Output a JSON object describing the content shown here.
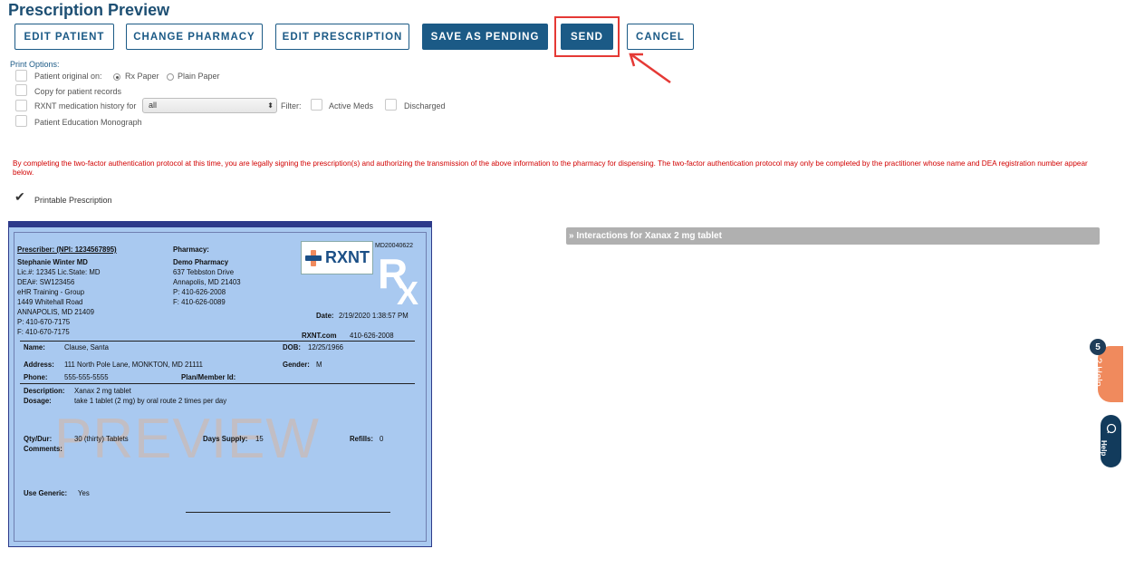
{
  "page": {
    "title": "Prescription Preview"
  },
  "toolbar": {
    "edit_patient": "EDIT PATIENT",
    "change_pharmacy": "CHANGE PHARMACY",
    "edit_prescription": "EDIT PRESCRIPTION",
    "save_pending": "SAVE AS PENDING",
    "send": "SEND",
    "cancel": "CANCEL"
  },
  "print_options": {
    "label": "Print Options:",
    "patient_original": "Patient original on:",
    "rx_paper": "Rx Paper",
    "plain_paper": "Plain Paper",
    "copy_records": "Copy for patient records",
    "med_history": "RXNT medication history for",
    "med_history_value": "all",
    "filter": "Filter:",
    "active_meds": "Active Meds",
    "discharged": "Discharged",
    "education": "Patient Education Monograph"
  },
  "warning": "By completing the two-factor authentication protocol at this time, you are legally signing the prescription(s) and authorizing the transmission of the above information to the pharmacy for dispensing. The two-factor authentication protocol may only be completed by the practitioner whose name and DEA registration number appear below.",
  "printable": "Printable Prescription",
  "rx": {
    "prescriber_header": "Prescriber: (NPI: 1234567895)",
    "prescriber_lines": [
      "Stephanie Winter MD",
      "Lic.#: 12345 Lic.State: MD",
      "DEA#: SW123456",
      "eHR Training - Group",
      "1449 Whitehall Road",
      "ANNAPOLIS,  MD 21409",
      "P: 410-670-7175",
      "F: 410-670-7175"
    ],
    "pharmacy_header": "Pharmacy:",
    "pharmacy_lines": [
      "Demo Pharmacy",
      "637 Tebbston Drive",
      "Annapolis,  MD 21403",
      "P: 410-626-2008",
      "F: 410-626-0089"
    ],
    "logo": "RXNT",
    "rx_id": "MD20040622",
    "rx_symbol": "R",
    "rx_symbol2": "X",
    "date_label": "Date:",
    "date_value": "2/19/2020 1:38:57 PM",
    "rxnt_site": "RXNT.com",
    "rxnt_phone": "410-626-2008",
    "name_label": "Name:",
    "name_value": "Clause, Santa",
    "dob_label": "DOB:",
    "dob_value": "12/25/1966",
    "address_label": "Address:",
    "address_value": "111 North Pole Lane, MONKTON, MD 21111",
    "gender_label": "Gender:",
    "gender_value": "M",
    "phone_label": "Phone:",
    "phone_value": "555-555-5555",
    "plan_label": "Plan/Member Id:",
    "description_label": "Description:",
    "description_value": "Xanax 2 mg tablet",
    "dosage_label": "Dosage:",
    "dosage_value": "take 1 tablet (2 mg) by oral route 2 times per day",
    "watermark": "PREVIEW",
    "qty_label": "Qty/Dur:",
    "qty_value": "30 (thirty) Tablets",
    "days_label": "Days Supply:",
    "days_value": "15",
    "refills_label": "Refills:",
    "refills_value": "0",
    "comments_label": "Comments:",
    "generic_label": "Use Generic:",
    "generic_value": "Yes"
  },
  "interactions": "» Interactions for Xanax 2 mg tablet",
  "help": {
    "badge": "5",
    "label": "? Help",
    "label2": "Help"
  },
  "colors": {
    "primary": "#1b5a86",
    "rx_background": "#a9c9f0",
    "highlight": "#e53935",
    "warning": "#d10000"
  }
}
